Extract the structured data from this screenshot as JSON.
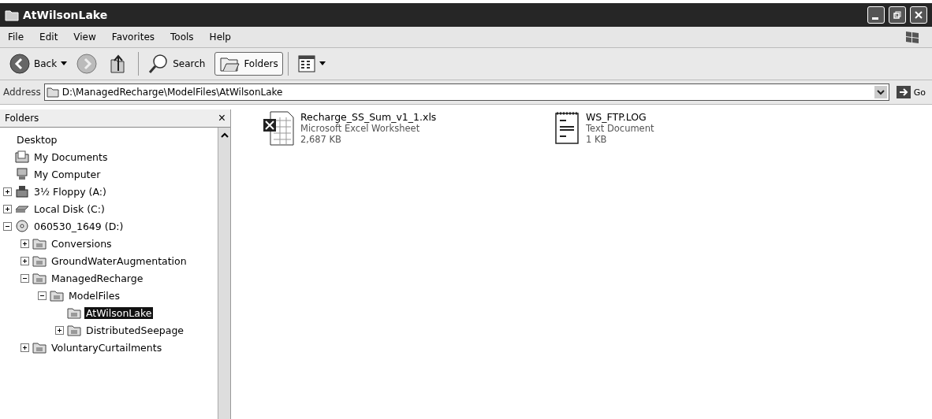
{
  "window": {
    "title": "AtWilsonLake"
  },
  "menu": [
    "File",
    "Edit",
    "View",
    "Favorites",
    "Tools",
    "Help"
  ],
  "toolbar": {
    "back": "Back",
    "search": "Search",
    "folders": {
      "label": "Folders",
      "selected": true
    }
  },
  "address": {
    "label": "Address",
    "value": "D:\\ManagedRecharge\\ModelFiles\\AtWilsonLake",
    "go": "Go"
  },
  "folders_pane": {
    "title": "Folders",
    "close": "×",
    "tree": [
      {
        "label": "Desktop",
        "kind": "desktop",
        "selected": false
      },
      {
        "label": "My Documents",
        "kind": "documents",
        "selected": false
      },
      {
        "label": "My Computer",
        "kind": "computer",
        "selected": false
      },
      {
        "label": "3½ Floppy (A:)",
        "kind": "floppy",
        "selected": false,
        "expanded": false
      },
      {
        "label": "Local Disk (C:)",
        "kind": "disk",
        "selected": false,
        "expanded": false
      },
      {
        "label": "060530_1649 (D:)",
        "kind": "cd",
        "selected": false,
        "expanded": true,
        "children": [
          {
            "label": "Conversions",
            "kind": "folder",
            "selected": false,
            "expanded": false
          },
          {
            "label": "GroundWaterAugmentation",
            "kind": "folder",
            "selected": false,
            "expanded": false
          },
          {
            "label": "ManagedRecharge",
            "kind": "folder",
            "selected": false,
            "expanded": true,
            "children": [
              {
                "label": "ModelFiles",
                "kind": "folder",
                "selected": false,
                "expanded": true,
                "children": [
                  {
                    "label": "AtWilsonLake",
                    "kind": "folder",
                    "selected": true
                  },
                  {
                    "label": "DistributedSeepage",
                    "kind": "folder",
                    "selected": false,
                    "expanded": false
                  }
                ]
              }
            ]
          },
          {
            "label": "VoluntaryCurtailments",
            "kind": "folder",
            "selected": false,
            "expanded": false
          }
        ]
      }
    ]
  },
  "files": [
    {
      "name": "Recharge_SS_Sum_v1_1.xls",
      "type": "Microsoft Excel Worksheet",
      "size": "2,687 KB",
      "kind": "excel"
    },
    {
      "name": "WS_FTP.LOG",
      "type": "Text Document",
      "size": "1 KB",
      "kind": "text"
    }
  ]
}
